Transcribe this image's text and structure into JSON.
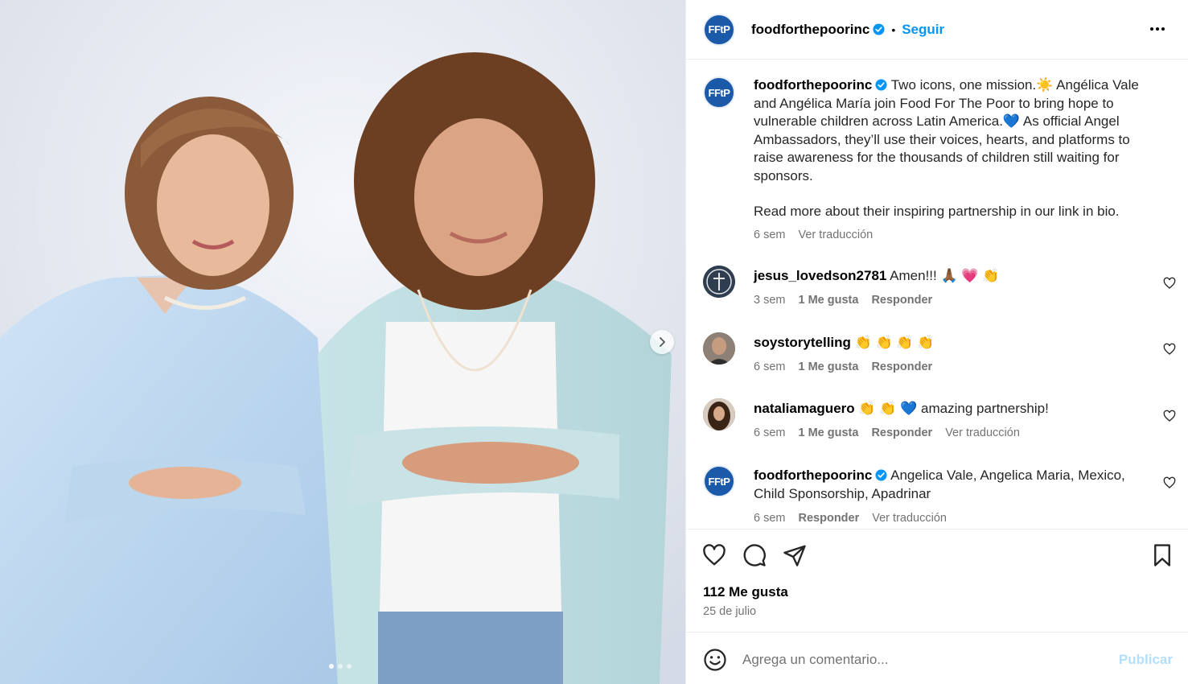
{
  "post": {
    "account": "foodforthepoorinc",
    "avatar_text": "FFtP",
    "follow_label": "Seguir",
    "separator": "•"
  },
  "caption": {
    "username": "foodforthepoorinc",
    "text": "Two icons, one mission.☀️  Angélica Vale and Angélica María join Food For The Poor to bring hope to vulnerable children across Latin America.💙 As official Angel Ambassadors, they’ll use their voices, hearts, and platforms to raise awareness for the thousands of children still waiting for sponsors.",
    "text2": "Read more about their inspiring partnership in our link in bio.",
    "time": "6 sem",
    "translate": "Ver traducción"
  },
  "comments": [
    {
      "username": "jesus_lovedson2781",
      "text": "Amen!!! 🙏🏾 💗 👏",
      "time": "3 sem",
      "likes": "1 Me gusta",
      "reply": "Responder"
    },
    {
      "username": "soystorytelling",
      "text": "👏 👏 👏 👏",
      "time": "6 sem",
      "likes": "1 Me gusta",
      "reply": "Responder"
    },
    {
      "username": "nataliamaguero",
      "text": "👏 👏 💙 amazing partnership!",
      "time": "6 sem",
      "likes": "1 Me gusta",
      "reply": "Responder",
      "translate": "Ver traducción"
    },
    {
      "username": "foodforthepoorinc",
      "text": "Angelica Vale, Angelica Maria, Mexico, Child Sponsorship, Apadrinar",
      "time": "6 sem",
      "reply": "Responder",
      "translate": "Ver traducción"
    }
  ],
  "stats": {
    "likes": "112 Me gusta",
    "date": "25 de julio"
  },
  "composer": {
    "placeholder": "Agrega un comentario...",
    "post_label": "Publicar"
  },
  "carousel": {
    "total": 3,
    "current": 1
  },
  "colors": {
    "accent": "#0095f6",
    "brand": "#1a5aa8",
    "muted": "#737373"
  }
}
